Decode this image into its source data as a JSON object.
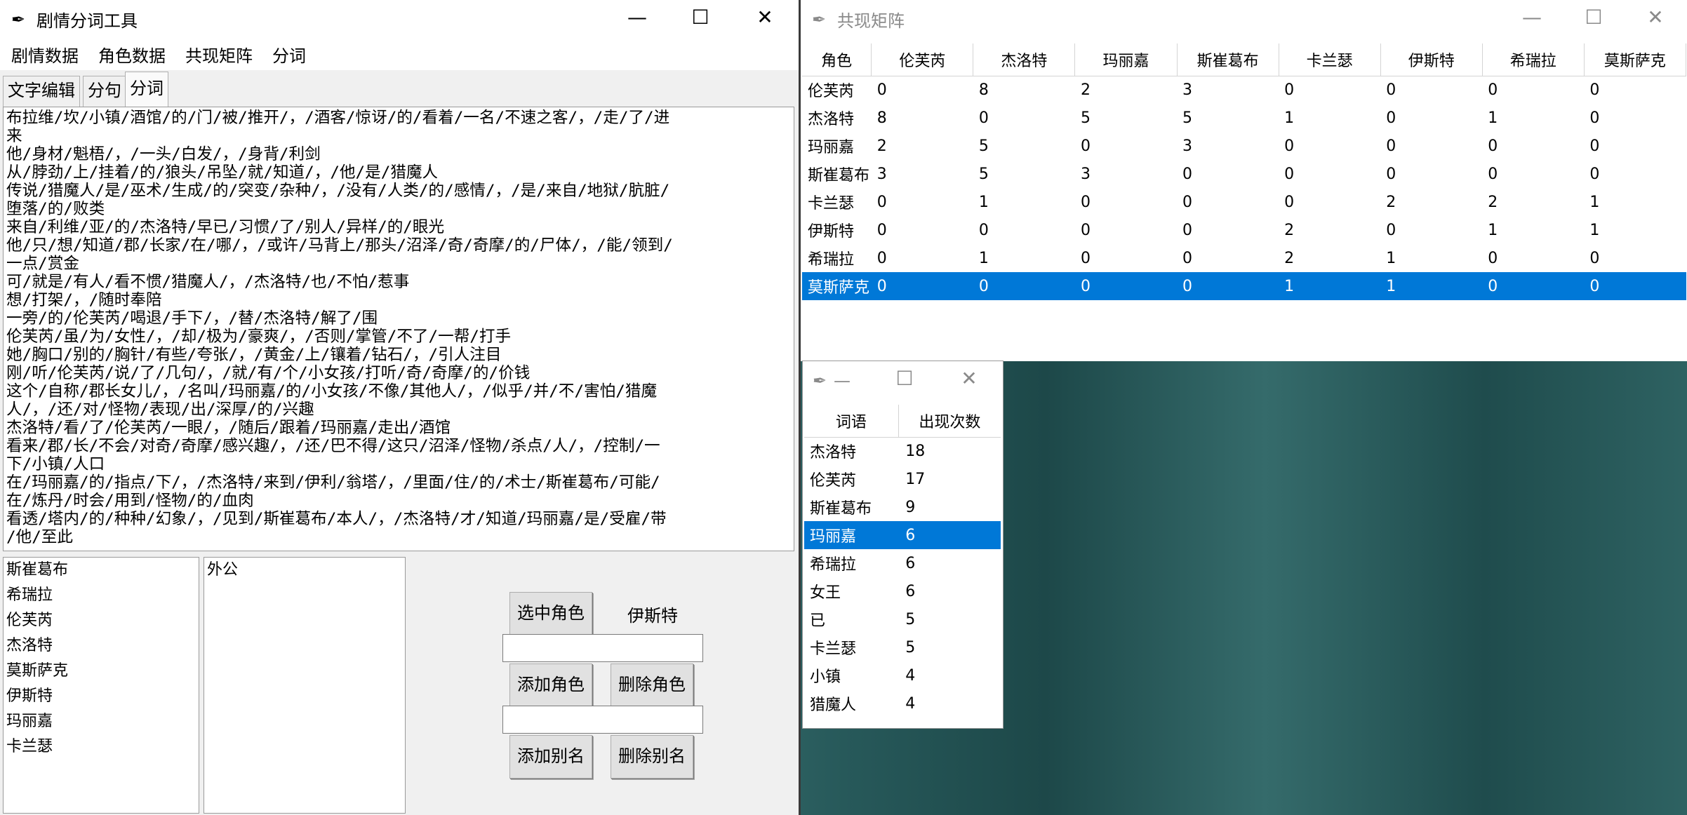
{
  "main_window": {
    "title": "剧情分词工具",
    "menu": [
      "剧情数据",
      "角色数据",
      "共现矩阵",
      "分词"
    ],
    "tabs": [
      "文字编辑",
      "分句",
      "分词"
    ],
    "text_lines": [
      "布拉维/坎/小镇/酒馆/的/门/被/推开/，/酒客/惊讶/的/看着/一名/不速之客/，/走/了/进",
      "来",
      "他/身材/魁梧/，/一头/白发/，/身背/利剑",
      "从/脖劲/上/挂着/的/狼头/吊坠/就/知道/，/他/是/猎魔人",
      "传说/猎魔人/是/巫术/生成/的/突变/杂种/，/没有/人类/的/感情/，/是/来自/地狱/肮脏/",
      "堕落/的/败类",
      "来自/利维/亚/的/杰洛特/早已/习惯/了/别人/异样/的/眼光",
      "他/只/想/知道/郡/长家/在/哪/，/或许/马背上/那头/沼泽/奇/奇摩/的/尸体/，/能/领到/",
      "一点/赏金",
      "可/就是/有人/看不惯/猎魔人/，/杰洛特/也/不怕/惹事",
      "想/打架/，/随时奉陪",
      "一旁/的/伦芙芮/喝退/手下/，/替/杰洛特/解了/围",
      "伦芙芮/虽/为/女性/，/却/极为/豪爽/，/否则/掌管/不了/一帮/打手",
      "她/胸口/别的/胸针/有些/夸张/，/黄金/上/镶着/钻石/，/引人注目",
      "刚/听/伦芙芮/说/了/几句/，/就/有/个/小女孩/打听/奇/奇摩/的/价钱",
      "这个/自称/郡长女儿/，/名叫/玛丽嘉/的/小女孩/不像/其他人/，/似乎/并/不/害怕/猎魔",
      "人/，/还/对/怪物/表现/出/深厚/的/兴趣",
      "杰洛特/看/了/伦芙芮/一眼/，/随后/跟着/玛丽嘉/走出/酒馆",
      "看来/郡/长/不会/对奇/奇摩/感兴趣/，/还/巴不得/这只/沼泽/怪物/杀点/人/，/控制/一",
      "下/小镇/人口",
      "在/玛丽嘉/的/指点/下/，/杰洛特/来到/伊利/翁塔/，/里面/住/的/术士/斯崔葛布/可能/",
      "在/炼丹/时会/用到/怪物/的/血肉",
      "看透/塔内/的/种种/幻象/，/见到/斯崔葛布/本人/，/杰洛特/才/知道/玛丽嘉/是/受雇/带",
      "/他/至此"
    ],
    "roles": [
      "斯崔葛布",
      "希瑞拉",
      "伦芙芮",
      "杰洛特",
      "莫斯萨克",
      "伊斯特",
      "玛丽嘉",
      "卡兰瑟"
    ],
    "aliases": [
      "外公"
    ],
    "buttons": {
      "select_role": "选中角色",
      "add_role": "添加角色",
      "delete_role": "删除角色",
      "add_alias": "添加别名",
      "delete_alias": "删除别名"
    },
    "selected_role": "伊斯特",
    "role_entry": "",
    "alias_entry": ""
  },
  "matrix_window": {
    "title": "共现矩阵",
    "header_corner": "角色",
    "columns": [
      "伦芙芮",
      "杰洛特",
      "玛丽嘉",
      "斯崔葛布",
      "卡兰瑟",
      "伊斯特",
      "希瑞拉",
      "莫斯萨克"
    ],
    "rows": [
      {
        "name": "伦芙芮",
        "values": [
          "0",
          "8",
          "2",
          "3",
          "0",
          "0",
          "0",
          "0"
        ]
      },
      {
        "name": "杰洛特",
        "values": [
          "8",
          "0",
          "5",
          "5",
          "1",
          "0",
          "1",
          "0"
        ]
      },
      {
        "name": "玛丽嘉",
        "values": [
          "2",
          "5",
          "0",
          "3",
          "0",
          "0",
          "0",
          "0"
        ]
      },
      {
        "name": "斯崔葛布",
        "values": [
          "3",
          "5",
          "3",
          "0",
          "0",
          "0",
          "0",
          "0"
        ]
      },
      {
        "name": "卡兰瑟",
        "values": [
          "0",
          "1",
          "0",
          "0",
          "0",
          "2",
          "2",
          "1"
        ]
      },
      {
        "name": "伊斯特",
        "values": [
          "0",
          "0",
          "0",
          "0",
          "2",
          "0",
          "1",
          "1"
        ]
      },
      {
        "name": "希瑞拉",
        "values": [
          "0",
          "1",
          "0",
          "0",
          "2",
          "1",
          "0",
          "0"
        ]
      },
      {
        "name": "莫斯萨克",
        "values": [
          "0",
          "0",
          "0",
          "0",
          "1",
          "1",
          "0",
          "0"
        ]
      }
    ],
    "selected_row": 7
  },
  "freq_window": {
    "title": "—",
    "columns": [
      "词语",
      "出现次数"
    ],
    "rows": [
      {
        "word": "杰洛特",
        "count": "18"
      },
      {
        "word": "伦芙芮",
        "count": "17"
      },
      {
        "word": "斯崔葛布",
        "count": "9"
      },
      {
        "word": "玛丽嘉",
        "count": "6"
      },
      {
        "word": "希瑞拉",
        "count": "6"
      },
      {
        "word": "女王",
        "count": "6"
      },
      {
        "word": "已",
        "count": "5"
      },
      {
        "word": "卡兰瑟",
        "count": "5"
      },
      {
        "word": "小镇",
        "count": "4"
      },
      {
        "word": "猎魔人",
        "count": "4"
      }
    ],
    "selected_row": 3
  },
  "icons": {
    "app": "feather-icon",
    "minimize": "minimize-icon",
    "maximize": "maximize-icon",
    "close": "close-icon"
  },
  "colors": {
    "selection": "#0078d7",
    "window_bg": "#f0f0f0"
  }
}
